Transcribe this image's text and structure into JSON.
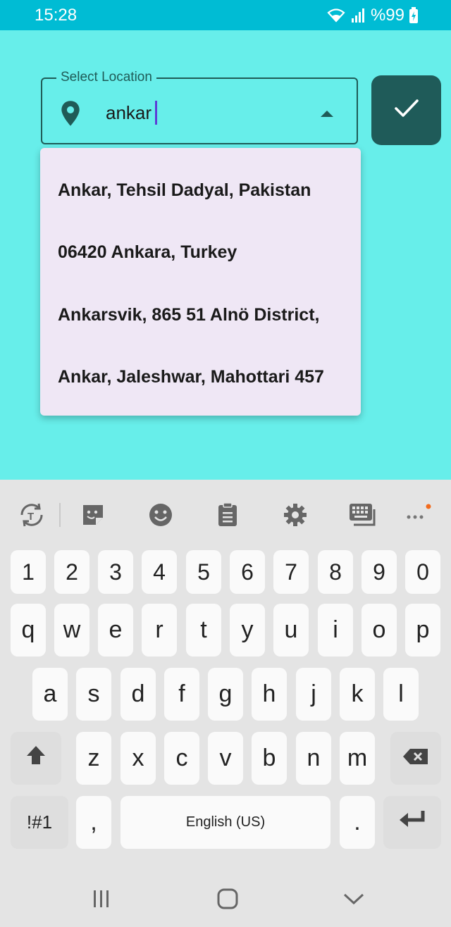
{
  "status_bar": {
    "time": "15:28",
    "battery": "%99"
  },
  "location_field": {
    "label": "Select Location",
    "value": "ankar"
  },
  "suggestions": [
    "Ankar, Tehsil Dadyal, Pakistan",
    "06420 Ankara, Turkey",
    "Ankarsvik, 865 51 Alnö District,",
    "Ankar, Jaleshwar, Mahottari 457"
  ],
  "keyboard": {
    "number_row": [
      "1",
      "2",
      "3",
      "4",
      "5",
      "6",
      "7",
      "8",
      "9",
      "0"
    ],
    "row1": [
      "q",
      "w",
      "e",
      "r",
      "t",
      "y",
      "u",
      "i",
      "o",
      "p"
    ],
    "row2": [
      "a",
      "s",
      "d",
      "f",
      "g",
      "h",
      "j",
      "k",
      "l"
    ],
    "row3": [
      "z",
      "x",
      "c",
      "v",
      "b",
      "n",
      "m"
    ],
    "symbols_key": "!#1",
    "comma_key": ",",
    "space_label": "English (US)",
    "period_key": "."
  },
  "colors": {
    "status_bar": "#00bcd4",
    "background": "#67eeea",
    "accent": "#1f5b59",
    "dropdown": "#efe7f5",
    "cursor": "#5c3fd6"
  },
  "icons": {
    "location": "map-pin-icon",
    "dropdown": "caret-up-icon",
    "confirm": "check-icon"
  }
}
